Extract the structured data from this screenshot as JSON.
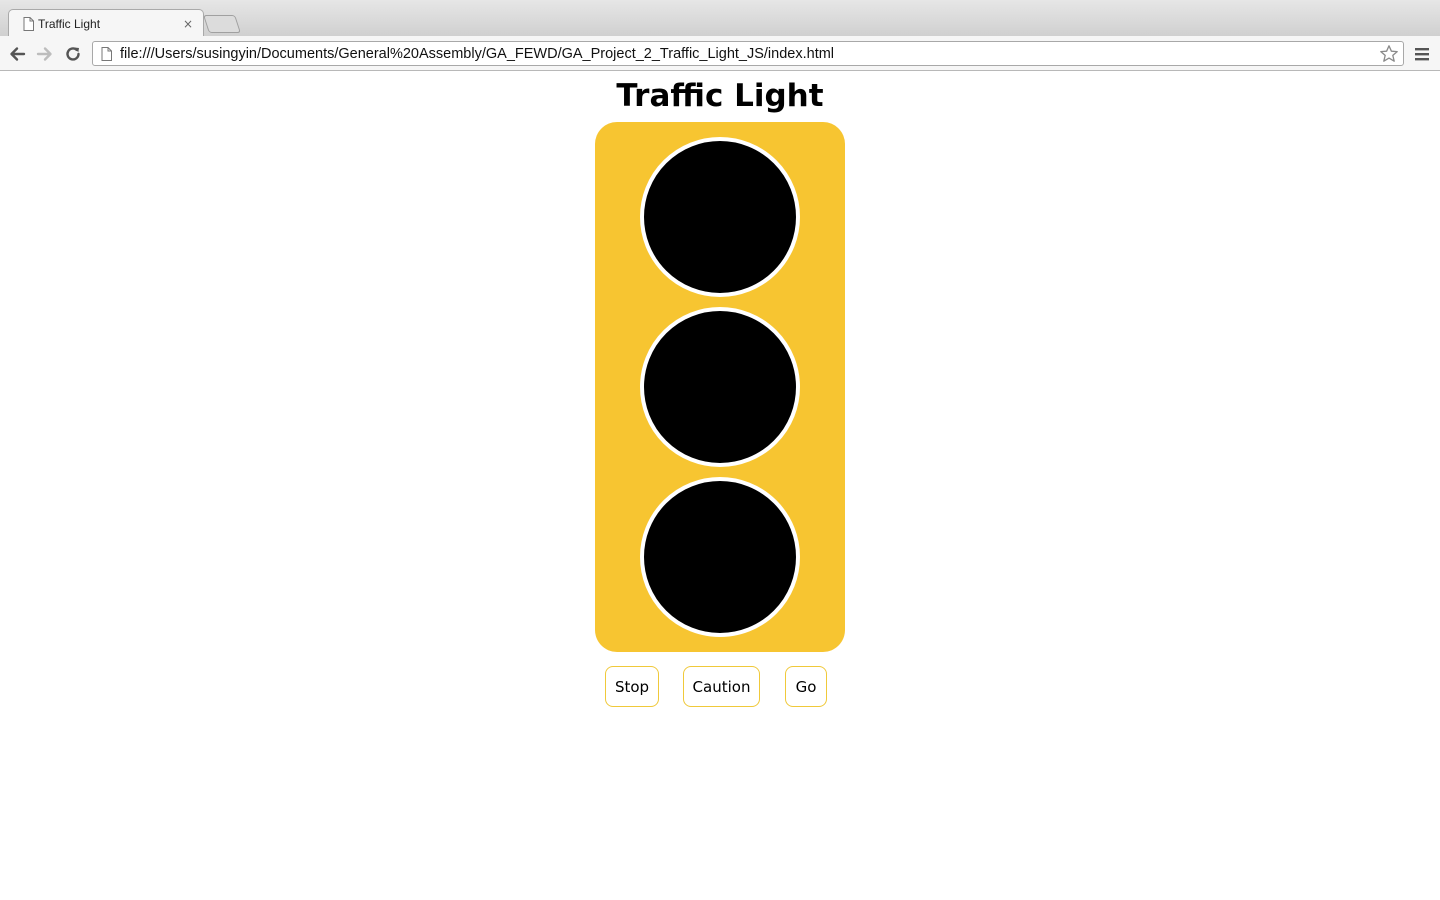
{
  "browser": {
    "tab_title": "Traffic Light",
    "tab_close": "×",
    "url": "file:///Users/susingyin/Documents/General%20Assembly/GA_FEWD/GA_Project_2_Traffic_Light_JS/index.html"
  },
  "page": {
    "title": "Traffic Light",
    "lights": [
      {
        "state": "off",
        "color": "#000000"
      },
      {
        "state": "off",
        "color": "#000000"
      },
      {
        "state": "off",
        "color": "#000000"
      }
    ],
    "housing_color": "#f7c531",
    "buttons": {
      "stop_label": "Stop",
      "caution_label": "Caution",
      "go_label": "Go"
    }
  }
}
